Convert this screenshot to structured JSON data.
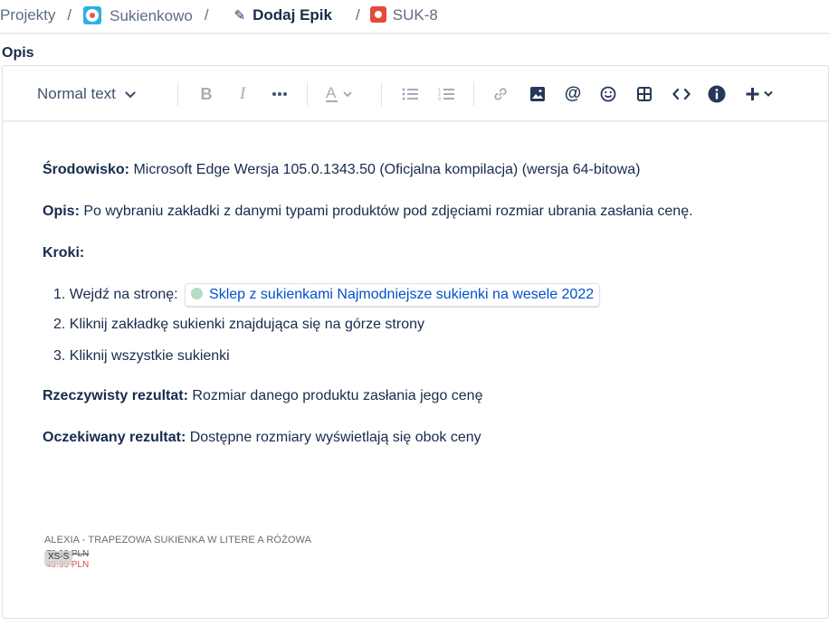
{
  "breadcrumb": {
    "projects": "Projekty",
    "separator": "/",
    "project": "Sukienkowo",
    "epic_action": "Dodaj Epik",
    "issue_key": "SUK-8"
  },
  "field": {
    "label": "Opis"
  },
  "toolbar": {
    "text_style": "Normal text",
    "icons": [
      "bold-icon",
      "italic-icon",
      "more-formatting-icon",
      "text-color-icon",
      "bullet-list-icon",
      "numbered-list-icon",
      "link-icon",
      "image-icon",
      "mention-icon",
      "emoji-icon",
      "table-icon",
      "code-icon",
      "info-panel-icon",
      "insert-more-icon"
    ]
  },
  "content": {
    "env_label": "Środowisko:",
    "env_value": " Microsoft Edge Wersja 105.0.1343.50 (Oficjalna kompilacja) (wersja 64-bitowa)",
    "desc_label": "Opis:",
    "desc_value": " Po wybraniu zakładki z danymi typami produktów pod zdjęciami rozmiar ubrania zasłania cenę.",
    "steps_label": "Kroki:",
    "steps": [
      {
        "num": "1.",
        "text": "Wejdź na stronę:",
        "link": "Sklep z sukienkami Najmodniejsze sukienki na wesele 2022"
      },
      {
        "num": "2.",
        "text": "Kliknij zakładkę sukienki znajdująca się na górze strony"
      },
      {
        "num": "3.",
        "text": "Kliknij wszystkie sukienki"
      }
    ],
    "actual_label": "Rzeczywisty rezultat:",
    "actual_value": " Rozmiar danego produktu zasłania jego cenę",
    "expected_label": "Oczekiwany rezultat:",
    "expected_value": " Dostępne rozmiary wyświetlają się obok ceny"
  },
  "screenshot": {
    "title": "ALEXIA - TRAPEZOWA SUKIENKA W LITERE A RÓŻOWA",
    "old_price": "79.99 PLN",
    "new_price": "49.99 PLN",
    "sizes": "XS-S"
  }
}
